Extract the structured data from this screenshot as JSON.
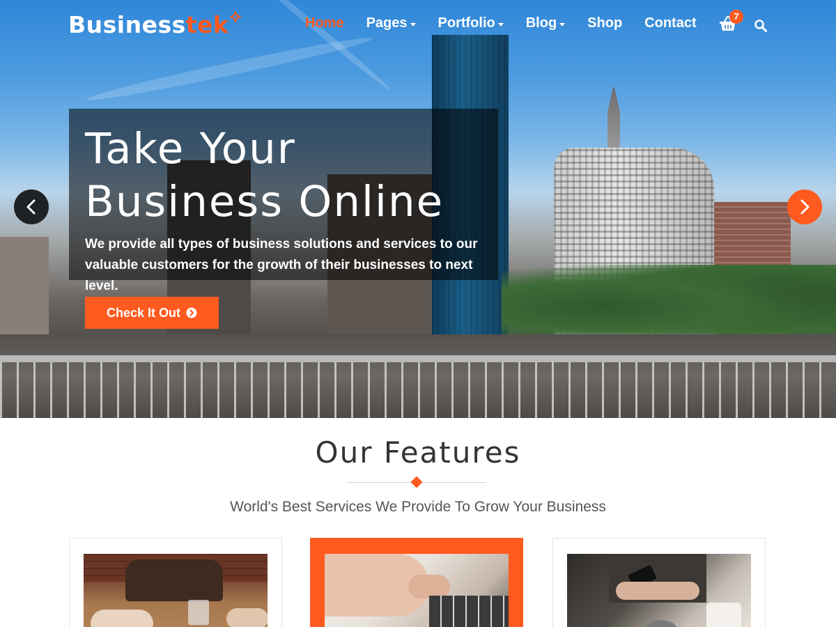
{
  "brand": {
    "name_part1": "Business",
    "name_part2": "tek",
    "accent_color": "#ff5a1f"
  },
  "nav": {
    "items": [
      {
        "label": "Home",
        "active": true,
        "has_dropdown": false
      },
      {
        "label": "Pages",
        "active": false,
        "has_dropdown": true
      },
      {
        "label": "Portfolio",
        "active": false,
        "has_dropdown": true
      },
      {
        "label": "Blog",
        "active": false,
        "has_dropdown": true
      },
      {
        "label": "Shop",
        "active": false,
        "has_dropdown": false
      },
      {
        "label": "Contact",
        "active": false,
        "has_dropdown": false
      }
    ],
    "cart_count": "7",
    "cart_icon": "shopping-basket-icon",
    "search_icon": "search-icon"
  },
  "hero": {
    "title_line1": "Take Your",
    "title_line2": "Business Online",
    "text_line1": "We provide all types of business solutions and services to our",
    "text_line2": "valuable customers for the growth of their businesses to next level.",
    "cta_label": "Check It Out",
    "cta_icon": "chevron-circle-right-icon",
    "prev_icon": "chevron-left-icon",
    "next_icon": "chevron-right-icon"
  },
  "features": {
    "title": "Our Features",
    "subtitle": "World's Best Services We Provide To Grow Your Business",
    "cards": [
      {
        "highlighted": false
      },
      {
        "highlighted": true
      },
      {
        "highlighted": false
      }
    ]
  }
}
